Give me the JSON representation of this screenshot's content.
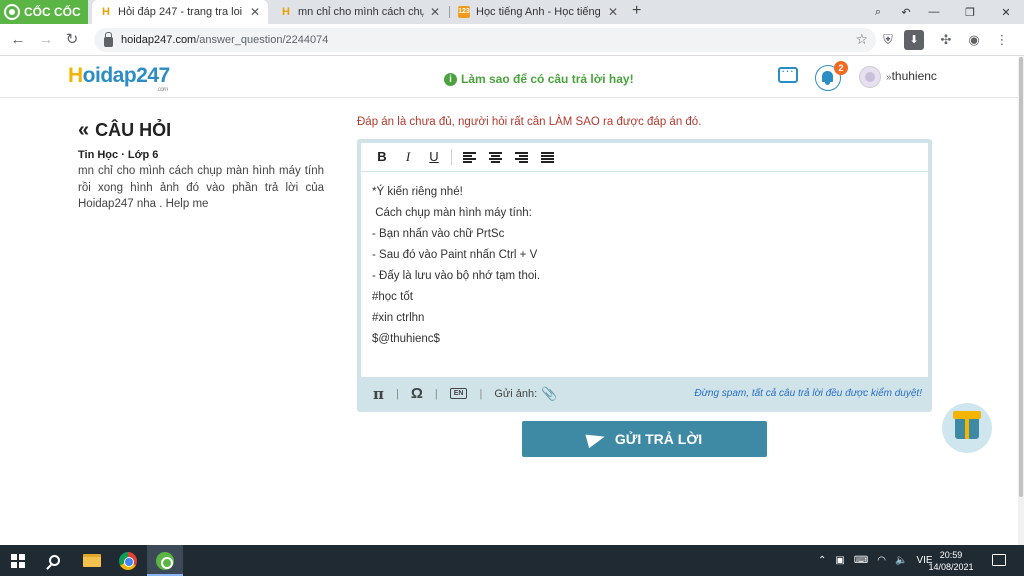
{
  "browser": {
    "brand": "CỐC CỐC",
    "tabs": [
      {
        "title": "Hỏi đáp 247 - trang tra loi",
        "favicon": "hoidap-favicon",
        "active": true
      },
      {
        "title": "mn chỉ cho mình cách chụp m",
        "favicon": "hoidap-favicon",
        "active": false
      },
      {
        "title": "Học tiếng Anh - Học tiếng An",
        "favicon": "hoc-favicon",
        "active": false
      }
    ],
    "url_host": "hoidap247.com",
    "url_path": "/answer_question/2244074"
  },
  "site": {
    "logo_prefix": "H",
    "logo_rest": "oidap247",
    "logo_com": ".com",
    "tip": "Làm sao để có câu trả lời hay!",
    "notification_count": "2",
    "username": "thuhienc"
  },
  "question": {
    "heading": "CÂU HỎI",
    "meta": "Tin Học · Lớp 6",
    "text": "mn chỉ cho mình cách chụp màn hình máy tính rồi xong hình ảnh đó vào phần trả lời của Hoidap247 nha . Help me"
  },
  "answer": {
    "warning": "Đáp án là chưa đủ, người hỏi rất cần LÀM SAO ra được đáp án đó.",
    "toolbar": {
      "bold": "B",
      "italic": "I",
      "underline": "U"
    },
    "lines": [
      "*Ý kiến riêng nhé!",
      " Cách chụp màn hình máy tính:",
      "- Bạn nhấn vào chữ PrtSc",
      "- Sau đó vào Paint nhấn Ctrl + V",
      "- Đấy là lưu vào bộ nhớ tạm thoi.",
      "#học tốt",
      "#xin ctrlhn",
      "$@thuhienc$"
    ],
    "footer": {
      "pi": "π",
      "omega": "Ω",
      "en": "EN",
      "send_image": "Gửi ảnh:",
      "spam_note": "Đừng spam, tất cả câu trả lời đều được kiểm duyệt!"
    },
    "submit_label": "GỬI TRẢ LỜI"
  },
  "taskbar": {
    "language": "VIE",
    "time": "20:59",
    "date": "14/08/2021"
  },
  "colors": {
    "brand_blue": "#2b8dc4",
    "submit": "#3e8aa5",
    "warning": "#b23a2e",
    "tip_green": "#4aa33d",
    "editor_frame": "#cfe3e9"
  }
}
